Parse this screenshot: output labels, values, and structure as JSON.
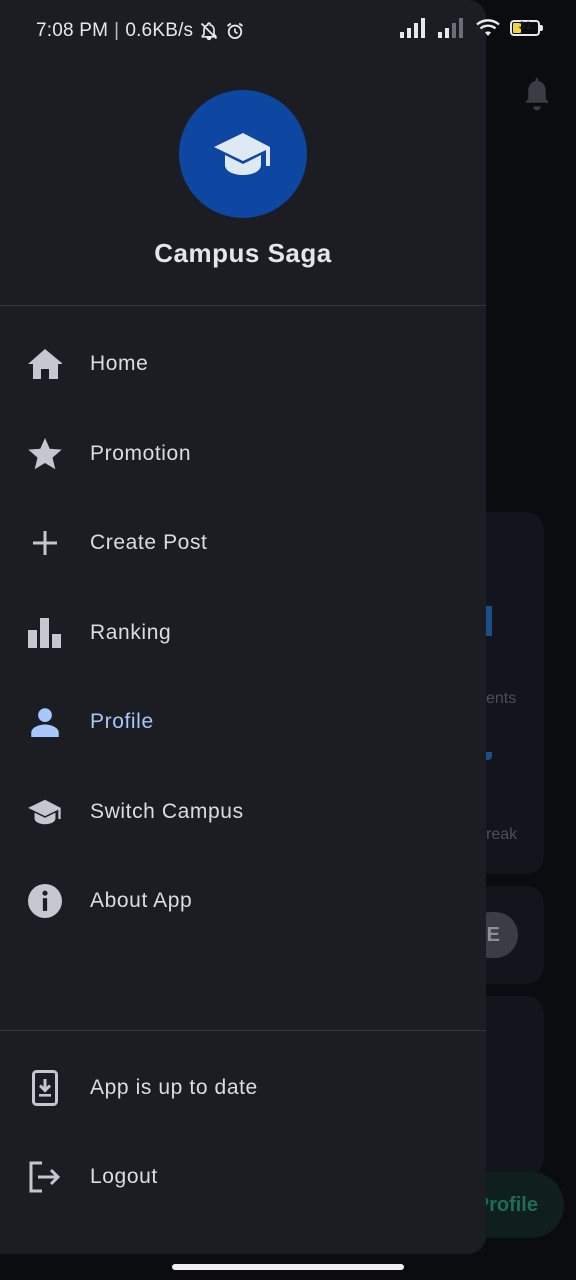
{
  "status_bar": {
    "time": "7:08 PM",
    "speed": "0.6KB/s",
    "battery_level": "31"
  },
  "drawer": {
    "app_name": "Campus Saga",
    "logo_icon": "graduation-cap-icon",
    "accent_color": "#0d47a1",
    "active_color": "#a8c7fa",
    "menu": [
      {
        "label": "Home",
        "icon": "home-icon"
      },
      {
        "label": "Promotion",
        "icon": "star-icon"
      },
      {
        "label": "Create Post",
        "icon": "plus-icon"
      },
      {
        "label": "Ranking",
        "icon": "bar-chart-icon"
      },
      {
        "label": "Profile",
        "icon": "person-icon",
        "active": true
      },
      {
        "label": "Switch Campus",
        "icon": "graduation-cap-icon"
      },
      {
        "label": "About App",
        "icon": "info-icon"
      }
    ],
    "footer": [
      {
        "label": "App is up to date",
        "icon": "phone-download-icon"
      },
      {
        "label": "Logout",
        "icon": "logout-icon"
      }
    ]
  },
  "background": {
    "text_ents": "ents",
    "text_reak": "reak",
    "badge_letter": "E",
    "profile_button": "Profile"
  }
}
